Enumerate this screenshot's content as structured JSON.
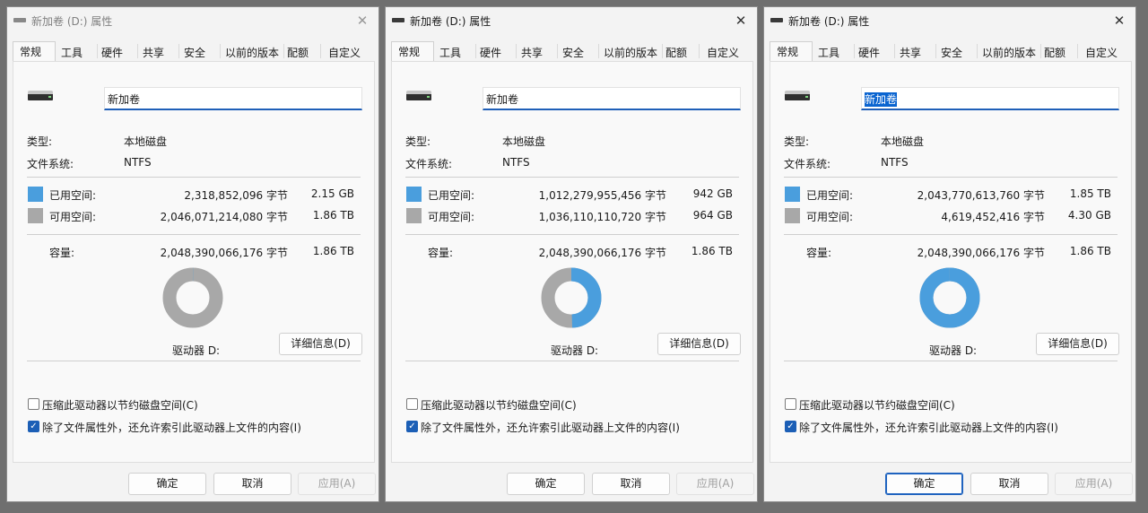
{
  "windows": [
    {
      "title": "新加卷 (D:) 属性",
      "close_icon": "✕",
      "tabs": [
        "常规",
        "工具",
        "硬件",
        "共享",
        "安全",
        "以前的版本",
        "配额",
        "自定义"
      ],
      "volume_name": "新加卷",
      "type_label": "类型:",
      "type_value": "本地磁盘",
      "fs_label": "文件系统:",
      "fs_value": "NTFS",
      "used_label": "已用空间:",
      "used_bytes": "2,318,852,096 字节",
      "used_size": "2.15 GB",
      "free_label": "可用空间:",
      "free_bytes": "2,046,071,214,080 字节",
      "free_size": "1.86 TB",
      "capacity_label": "容量:",
      "capacity_bytes": "2,048,390,066,176 字节",
      "capacity_size": "1.86 TB",
      "used_fraction": 0.0011,
      "drive_label": "驱动器 D:",
      "details_button": "详细信息(D)",
      "compress_label": "压缩此驱动器以节约磁盘空间(C)",
      "index_label": "除了文件属性外，还允许索引此驱动器上文件的内容(I)",
      "ok": "确定",
      "cancel": "取消",
      "apply": "应用(A)"
    },
    {
      "title": "新加卷 (D:) 属性",
      "close_icon": "✕",
      "tabs": [
        "常规",
        "工具",
        "硬件",
        "共享",
        "安全",
        "以前的版本",
        "配额",
        "自定义"
      ],
      "volume_name": "新加卷",
      "type_label": "类型:",
      "type_value": "本地磁盘",
      "fs_label": "文件系统:",
      "fs_value": "NTFS",
      "used_label": "已用空间:",
      "used_bytes": "1,012,279,955,456 字节",
      "used_size": "942 GB",
      "free_label": "可用空间:",
      "free_bytes": "1,036,110,110,720 字节",
      "free_size": "964 GB",
      "capacity_label": "容量:",
      "capacity_bytes": "2,048,390,066,176 字节",
      "capacity_size": "1.86 TB",
      "used_fraction": 0.4942,
      "drive_label": "驱动器 D:",
      "details_button": "详细信息(D)",
      "compress_label": "压缩此驱动器以节约磁盘空间(C)",
      "index_label": "除了文件属性外，还允许索引此驱动器上文件的内容(I)",
      "ok": "确定",
      "cancel": "取消",
      "apply": "应用(A)"
    },
    {
      "title": "新加卷 (D:) 属性",
      "close_icon": "✕",
      "tabs": [
        "常规",
        "工具",
        "硬件",
        "共享",
        "安全",
        "以前的版本",
        "配额",
        "自定义"
      ],
      "volume_name": "新加卷",
      "type_label": "类型:",
      "type_value": "本地磁盘",
      "fs_label": "文件系统:",
      "fs_value": "NTFS",
      "used_label": "已用空间:",
      "used_bytes": "2,043,770,613,760 字节",
      "used_size": "1.85 TB",
      "free_label": "可用空间:",
      "free_bytes": "4,619,452,416 字节",
      "free_size": "4.30 GB",
      "capacity_label": "容量:",
      "capacity_bytes": "2,048,390,066,176 字节",
      "capacity_size": "1.86 TB",
      "used_fraction": 0.9977,
      "drive_label": "驱动器 D:",
      "details_button": "详细信息(D)",
      "compress_label": "压缩此驱动器以节约磁盘空间(C)",
      "index_label": "除了文件属性外，还允许索引此驱动器上文件的内容(I)",
      "ok": "确定",
      "cancel": "取消",
      "apply": "应用(A)"
    }
  ],
  "colors": {
    "used": "#4a9edd",
    "free": "#a8a8a8",
    "accent": "#1f63bf"
  }
}
